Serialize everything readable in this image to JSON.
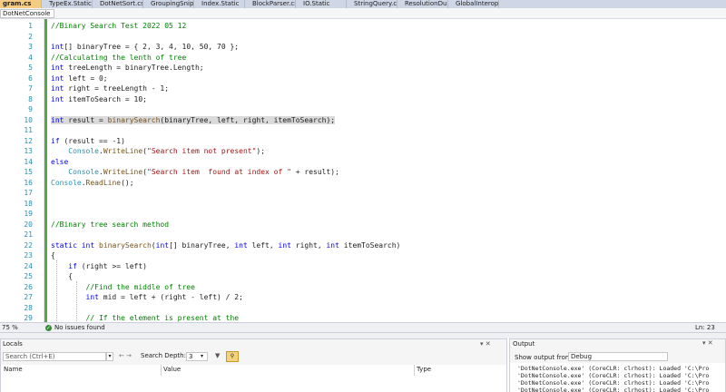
{
  "tabs": [
    {
      "label": "gram.cs",
      "active": true
    },
    {
      "label": "TypeEx.Static"
    },
    {
      "label": "DotNetSort.cs"
    },
    {
      "label": "GroupingSnippets.cs"
    },
    {
      "label": "Index.Static"
    },
    {
      "label": "BlockParser.cs"
    },
    {
      "label": "IO.Static"
    },
    {
      "label": "StringQuery.cs"
    },
    {
      "label": "ResolutionDurability.cs"
    },
    {
      "label": "GlobalInterop.cs"
    }
  ],
  "nav": {
    "project": "DotNetConsole"
  },
  "editor": {
    "line_numbers": [
      "1",
      "2",
      "3",
      "4",
      "5",
      "6",
      "7",
      "8",
      "9",
      "10",
      "11",
      "12",
      "13",
      "14",
      "15",
      "16",
      "17",
      "18",
      "19",
      "20",
      "21",
      "22",
      "23",
      "24",
      "25",
      "26",
      "27",
      "28",
      "29"
    ],
    "lines": [
      [
        {
          "c": "cm",
          "t": "//Binary Search Test 2022 05 12"
        }
      ],
      [],
      [
        {
          "c": "kw",
          "t": "int"
        },
        {
          "c": "",
          "t": "[] binaryTree = { 2, 3, 4, 10, 50, 70 };"
        }
      ],
      [
        {
          "c": "cm",
          "t": "//Calculating the lenth of tree"
        }
      ],
      [
        {
          "c": "kw",
          "t": "int"
        },
        {
          "c": "",
          "t": " treeLength = binaryTree.Length;"
        }
      ],
      [
        {
          "c": "kw",
          "t": "int"
        },
        {
          "c": "",
          "t": " left = 0;"
        }
      ],
      [
        {
          "c": "kw",
          "t": "int"
        },
        {
          "c": "",
          "t": " right = treeLength - 1;"
        }
      ],
      [
        {
          "c": "kw",
          "t": "int"
        },
        {
          "c": "",
          "t": " itemToSearch = 10;"
        }
      ],
      [],
      [
        {
          "c": "kw",
          "t": "int"
        },
        {
          "c": "",
          "t": " result = "
        },
        {
          "c": "fn",
          "t": "binarySearch"
        },
        {
          "c": "",
          "t": "(binaryTree, left, right, itemToSearch);"
        }
      ],
      [],
      [
        {
          "c": "kw",
          "t": "if"
        },
        {
          "c": "",
          "t": " (result == -1)"
        }
      ],
      [
        {
          "c": "",
          "t": "    "
        },
        {
          "c": "ty",
          "t": "Console"
        },
        {
          "c": "",
          "t": "."
        },
        {
          "c": "fn",
          "t": "WriteLine"
        },
        {
          "c": "",
          "t": "("
        },
        {
          "c": "st",
          "t": "\"Search item not present\""
        },
        {
          "c": "",
          "t": ");"
        }
      ],
      [
        {
          "c": "kw",
          "t": "else"
        }
      ],
      [
        {
          "c": "",
          "t": "    "
        },
        {
          "c": "ty",
          "t": "Console"
        },
        {
          "c": "",
          "t": "."
        },
        {
          "c": "fn",
          "t": "WriteLine"
        },
        {
          "c": "",
          "t": "("
        },
        {
          "c": "st",
          "t": "\"Search item  found at index of \""
        },
        {
          "c": "",
          "t": " + result);"
        }
      ],
      [
        {
          "c": "ty",
          "t": "Console"
        },
        {
          "c": "",
          "t": "."
        },
        {
          "c": "fn",
          "t": "ReadLine"
        },
        {
          "c": "",
          "t": "();"
        }
      ],
      [],
      [],
      [],
      [
        {
          "c": "cm",
          "t": "//Binary tree search method"
        }
      ],
      [],
      [
        {
          "c": "kw",
          "t": "static int"
        },
        {
          "c": "",
          "t": " "
        },
        {
          "c": "fn",
          "t": "binarySearch"
        },
        {
          "c": "",
          "t": "("
        },
        {
          "c": "kw",
          "t": "int"
        },
        {
          "c": "",
          "t": "[] binaryTree, "
        },
        {
          "c": "kw",
          "t": "int"
        },
        {
          "c": "",
          "t": " left, "
        },
        {
          "c": "kw",
          "t": "int"
        },
        {
          "c": "",
          "t": " right, "
        },
        {
          "c": "kw",
          "t": "int"
        },
        {
          "c": "",
          "t": " itemToSearch)"
        }
      ],
      [
        {
          "c": "",
          "t": "{"
        }
      ],
      [
        {
          "c": "",
          "t": "    "
        },
        {
          "c": "kw",
          "t": "if"
        },
        {
          "c": "",
          "t": " (right >= left)"
        }
      ],
      [
        {
          "c": "",
          "t": "    {"
        }
      ],
      [
        {
          "c": "",
          "t": "        "
        },
        {
          "c": "cm",
          "t": "//Find the middle of tree"
        }
      ],
      [
        {
          "c": "",
          "t": "        "
        },
        {
          "c": "kw",
          "t": "int"
        },
        {
          "c": "",
          "t": " mid = left + (right - left) / 2;"
        }
      ],
      [],
      [
        {
          "c": "",
          "t": "        "
        },
        {
          "c": "cm",
          "t": "// If the element is present at the"
        }
      ]
    ],
    "highlight_line": 10
  },
  "status": {
    "zoom": "75 %",
    "issues": "No issues found",
    "position": "Ln: 23"
  },
  "locals": {
    "title": "Locals",
    "controls": "▾ ✕",
    "search_placeholder": "Search (Ctrl+E)",
    "nav_arrows": "← →",
    "search_depth_label": "Search Depth:",
    "search_depth_value": "3",
    "columns": [
      "Name",
      "Value",
      "Type"
    ]
  },
  "output": {
    "title": "Output",
    "controls": "▾ ✕",
    "show_label": "Show output from:",
    "show_value": "Debug",
    "lines": [
      "'DotNetConsole.exe' (CoreCLR: clrhost): Loaded 'C:\\Pro",
      "'DotNetConsole.exe' (CoreCLR: clrhost): Loaded 'C:\\Pro",
      "'DotNetConsole.exe' (CoreCLR: clrhost): Loaded 'C:\\Pro",
      "'DotNetConsole.exe' (CoreCLR: clrhost): Loaded 'C:\\Pro"
    ]
  }
}
